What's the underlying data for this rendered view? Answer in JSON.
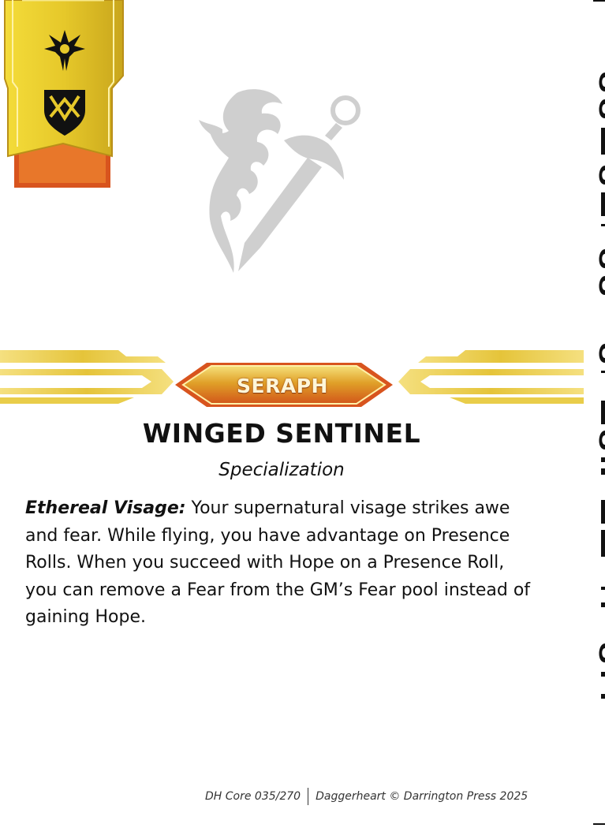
{
  "card": {
    "subclass_badge": "SERAPH",
    "title": "WINGED SENTINEL",
    "type": "Specialization",
    "ability": {
      "name": "Ethereal Visage:",
      "text": "Your supernatural visage strikes awe and fear. While flying, you have advantage on Presence Rolls. When you succeed with Hope on a Presence Roll, you can remove a Fear from the GM’s Fear pool instead of gaining Hope."
    },
    "footer": {
      "set_number": "DH Core 035/270",
      "copyright": "Daggerheart © Darrington Press 2025"
    }
  },
  "icons": {
    "banner_top": "splendor-domain-icon",
    "banner_bottom": "valor-domain-icon",
    "emblem": "seraph-class-emblem"
  },
  "colors": {
    "banner_gold": "#e3c528",
    "banner_orange": "#d8541e",
    "badge_orange": "#e06a1c",
    "emblem_gray": "#cfcfcf",
    "text": "#111111"
  }
}
